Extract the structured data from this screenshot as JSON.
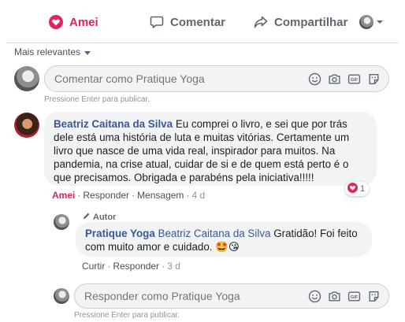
{
  "action_bar": {
    "like_label": "Amei",
    "comment_label": "Comentar",
    "share_label": "Compartilhar",
    "like_color": "#e0245e"
  },
  "sort": {
    "label": "Mais relevantes"
  },
  "main_composer": {
    "placeholder": "Comentar como Pratique Yoga",
    "hint": "Pressione Enter para publicar."
  },
  "comment": {
    "author": "Beatriz Caitana da Silva",
    "text": "Eu comprei o livro, e sei que por trás dele está uma história de luta e muitas vitórias. Certamente um livro que nasce de uma vida real, inspirador para muitos. Na pandemia, na crise atual, cuidar de si e de quem está perto é o que precisamos. Obrigada e parabéns pela iniciativa!!!!!",
    "actions": {
      "reaction": "Amei",
      "reply": "Responder",
      "message": "Mensagem",
      "time": "4 d"
    },
    "reaction_count": "1"
  },
  "reply": {
    "author_badge": "Autor",
    "author": "Pratique Yoga",
    "mention": "Beatriz Caitana da Silva",
    "text": "Gratidão! Foi feito com muito amor e cuidado. 🤩😘",
    "actions": {
      "like": "Curtir",
      "reply": "Responder",
      "time": "3 d"
    }
  },
  "reply_composer": {
    "placeholder": "Responder como Pratique Yoga",
    "hint": "Pressione Enter para publicar."
  },
  "composer_icons": [
    "emoji-icon",
    "camera-icon",
    "gif-icon",
    "sticker-icon"
  ]
}
